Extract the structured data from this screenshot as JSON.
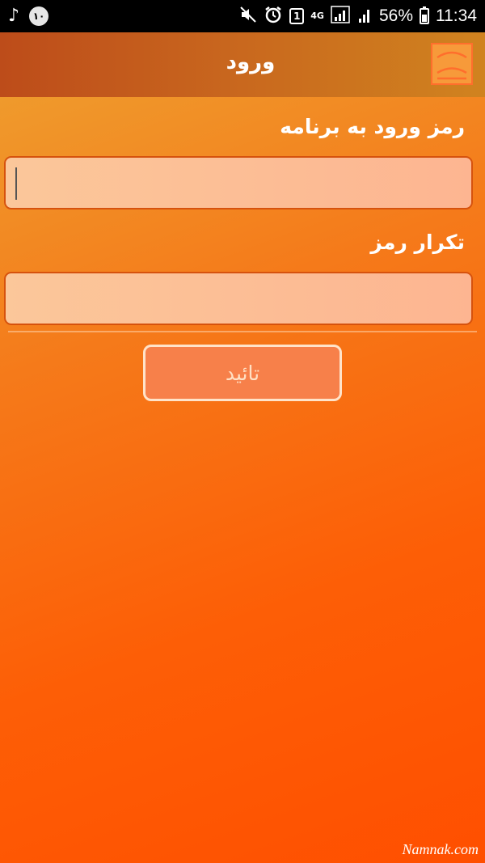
{
  "status_bar": {
    "badge": "١٠",
    "sim_number": "1",
    "network_type": "4G",
    "battery_percent": "56%",
    "time": "11:34",
    "icons": [
      "music-note-icon",
      "muted-icon",
      "alarm-icon",
      "sim-icon",
      "signal-icon",
      "battery-icon"
    ]
  },
  "app_bar": {
    "title": "ورود",
    "menu_icon": "menu-arc-icon"
  },
  "form": {
    "password_label": "رمز ورود به برنامه",
    "password_value": "",
    "confirm_label": "تکرار رمز",
    "confirm_value": "",
    "submit_label": "تائید"
  },
  "watermark": "Namnak.com",
  "colors": {
    "app_bar": "#c9681e",
    "background": "#ff5a0a",
    "field": "#fbc79a",
    "button": "#f7804a"
  }
}
